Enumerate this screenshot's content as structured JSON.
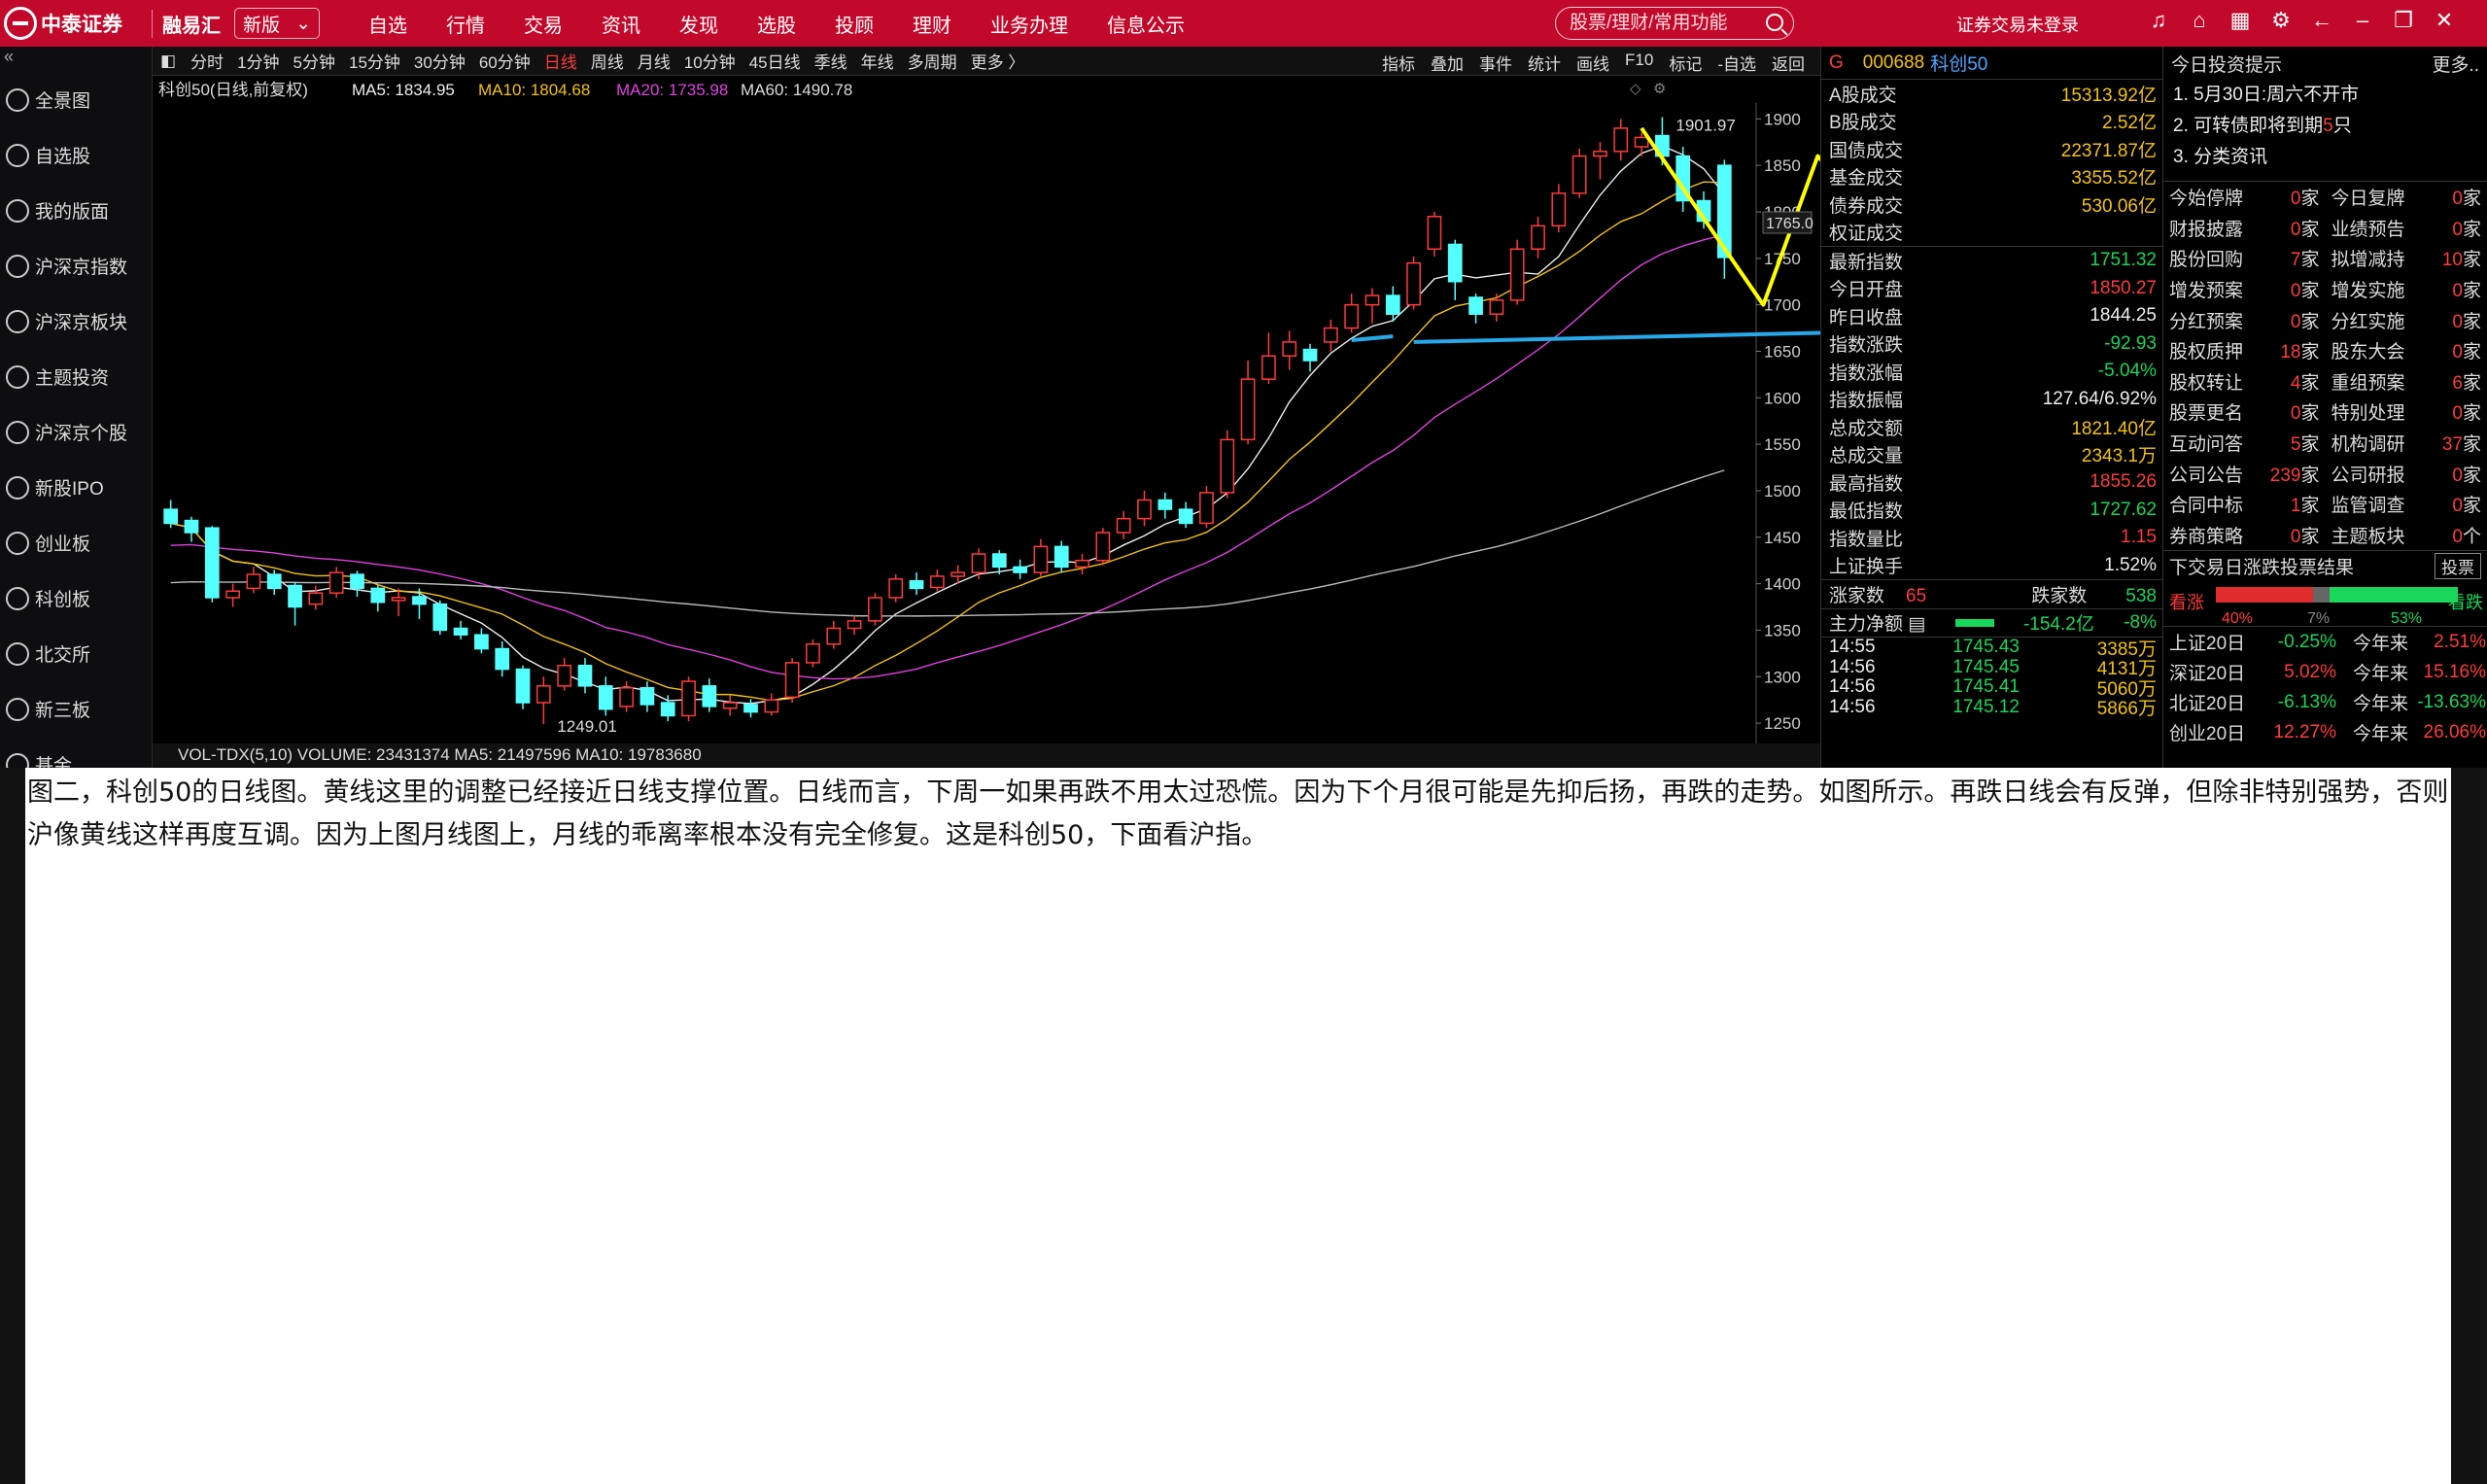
{
  "topbar": {
    "logo": "中泰证券",
    "brand": "融易汇",
    "version_select": "新版",
    "menu": [
      "自选",
      "行情",
      "交易",
      "资讯",
      "发现",
      "选股",
      "投顾",
      "理财",
      "业务办理",
      "信息公示"
    ],
    "search_placeholder": "股票/理财/常用功能",
    "login_status": "证券交易未登录"
  },
  "sidebar": {
    "items": [
      "全景图",
      "自选股",
      "我的版面",
      "沪深京指数",
      "沪深京板块",
      "主题投资",
      "沪深京个股",
      "新股IPO",
      "创业板",
      "科创板",
      "北交所",
      "新三板",
      "基金"
    ]
  },
  "toolbar": {
    "periods": [
      "分时",
      "1分钟",
      "5分钟",
      "15分钟",
      "30分钟",
      "60分钟",
      "日线",
      "周线",
      "月线",
      "10分钟",
      "45日线",
      "季线",
      "年线",
      "多周期",
      "更多 〉"
    ],
    "active_period": "日线",
    "tools": [
      "指标",
      "叠加",
      "事件",
      "统计",
      "画线",
      "F10",
      "标记",
      "-自选",
      "返回"
    ]
  },
  "chart_header": {
    "name": "科创50(日线,前复权)",
    "ma5": "MA5: 1834.95",
    "ma10": "MA10: 1804.68",
    "ma20": "MA20: 1735.98",
    "ma60": "MA60: 1490.78",
    "high_label": "1901.97",
    "low_label": "1249.01",
    "price_tag": "1765.0"
  },
  "chart_data": {
    "type": "candlestick",
    "y_ticks": [
      1900,
      1850,
      1800,
      1750,
      1700,
      1650,
      1600,
      1550,
      1500,
      1450,
      1400,
      1350,
      1300,
      1250
    ],
    "ylim": [
      1225,
      1915
    ],
    "candles": [
      [
        1480,
        1465,
        1490,
        1460
      ],
      [
        1468,
        1455,
        1472,
        1445
      ],
      [
        1460,
        1385,
        1462,
        1380
      ],
      [
        1385,
        1392,
        1400,
        1375
      ],
      [
        1395,
        1410,
        1418,
        1390
      ],
      [
        1410,
        1395,
        1415,
        1388
      ],
      [
        1398,
        1375,
        1402,
        1355
      ],
      [
        1378,
        1390,
        1398,
        1372
      ],
      [
        1390,
        1412,
        1418,
        1385
      ],
      [
        1410,
        1395,
        1414,
        1386
      ],
      [
        1395,
        1380,
        1398,
        1370
      ],
      [
        1382,
        1385,
        1395,
        1365
      ],
      [
        1386,
        1378,
        1395,
        1362
      ],
      [
        1378,
        1350,
        1382,
        1345
      ],
      [
        1352,
        1345,
        1360,
        1340
      ],
      [
        1345,
        1330,
        1352,
        1325
      ],
      [
        1330,
        1308,
        1338,
        1300
      ],
      [
        1308,
        1272,
        1312,
        1265
      ],
      [
        1272,
        1290,
        1300,
        1249
      ],
      [
        1290,
        1312,
        1320,
        1285
      ],
      [
        1312,
        1290,
        1320,
        1282
      ],
      [
        1290,
        1265,
        1300,
        1258
      ],
      [
        1268,
        1288,
        1295,
        1262
      ],
      [
        1288,
        1270,
        1295,
        1262
      ],
      [
        1272,
        1258,
        1280,
        1252
      ],
      [
        1258,
        1295,
        1300,
        1252
      ],
      [
        1290,
        1268,
        1298,
        1262
      ],
      [
        1266,
        1272,
        1280,
        1258
      ],
      [
        1270,
        1262,
        1276,
        1256
      ],
      [
        1262,
        1275,
        1282,
        1258
      ],
      [
        1278,
        1315,
        1320,
        1272
      ],
      [
        1315,
        1335,
        1340,
        1310
      ],
      [
        1335,
        1352,
        1360,
        1330
      ],
      [
        1352,
        1360,
        1366,
        1345
      ],
      [
        1360,
        1385,
        1390,
        1355
      ],
      [
        1385,
        1405,
        1410,
        1380
      ],
      [
        1403,
        1395,
        1412,
        1388
      ],
      [
        1396,
        1408,
        1415,
        1392
      ],
      [
        1408,
        1412,
        1420,
        1400
      ],
      [
        1412,
        1432,
        1438,
        1405
      ],
      [
        1432,
        1418,
        1436,
        1410
      ],
      [
        1418,
        1412,
        1426,
        1405
      ],
      [
        1412,
        1440,
        1448,
        1408
      ],
      [
        1440,
        1418,
        1446,
        1412
      ],
      [
        1418,
        1425,
        1432,
        1410
      ],
      [
        1425,
        1455,
        1460,
        1420
      ],
      [
        1455,
        1470,
        1478,
        1448
      ],
      [
        1470,
        1490,
        1500,
        1462
      ],
      [
        1490,
        1480,
        1498,
        1470
      ],
      [
        1480,
        1465,
        1488,
        1460
      ],
      [
        1465,
        1498,
        1505,
        1460
      ],
      [
        1498,
        1555,
        1565,
        1492
      ],
      [
        1555,
        1620,
        1640,
        1550
      ],
      [
        1620,
        1645,
        1670,
        1615
      ],
      [
        1645,
        1660,
        1672,
        1630
      ],
      [
        1652,
        1640,
        1658,
        1628
      ],
      [
        1660,
        1675,
        1684,
        1650
      ],
      [
        1675,
        1700,
        1712,
        1670
      ],
      [
        1700,
        1710,
        1718,
        1680
      ],
      [
        1710,
        1690,
        1720,
        1682
      ],
      [
        1700,
        1745,
        1752,
        1695
      ],
      [
        1760,
        1795,
        1800,
        1752
      ],
      [
        1765,
        1725,
        1770,
        1705
      ],
      [
        1708,
        1690,
        1712,
        1680
      ],
      [
        1690,
        1705,
        1712,
        1682
      ],
      [
        1705,
        1760,
        1770,
        1700
      ],
      [
        1760,
        1785,
        1795,
        1750
      ],
      [
        1785,
        1820,
        1830,
        1778
      ],
      [
        1820,
        1860,
        1868,
        1815
      ],
      [
        1860,
        1865,
        1875,
        1835
      ],
      [
        1865,
        1890,
        1900,
        1855
      ],
      [
        1870,
        1880,
        1885,
        1860
      ],
      [
        1882,
        1860,
        1902,
        1850
      ],
      [
        1860,
        1812,
        1870,
        1800
      ],
      [
        1812,
        1790,
        1822,
        1782
      ],
      [
        1850,
        1751,
        1856,
        1728
      ]
    ],
    "ma_lines": [
      "MA5",
      "MA10",
      "MA20",
      "MA60"
    ],
    "annotations": [
      "yellow zigzag projection",
      "blue support line"
    ]
  },
  "volume_bar": "VOL-TDX(5,10)  VOLUME: 23431374  MA5: 21497596  MA10: 19783680",
  "quote": {
    "g": "G",
    "code": "000688",
    "name": "科创50",
    "turnover": [
      {
        "label": "A股成交",
        "value": "15313.92亿"
      },
      {
        "label": "B股成交",
        "value": "2.52亿"
      },
      {
        "label": "国债成交",
        "value": "22371.87亿"
      },
      {
        "label": "基金成交",
        "value": "3355.52亿"
      },
      {
        "label": "债券成交",
        "value": "530.06亿"
      },
      {
        "label": "权证成交",
        "value": ""
      }
    ],
    "stats": [
      {
        "label": "最新指数",
        "value": "1751.32",
        "color": "green"
      },
      {
        "label": "今日开盘",
        "value": "1850.27",
        "color": "red"
      },
      {
        "label": "昨日收盘",
        "value": "1844.25",
        "color": "white"
      },
      {
        "label": "指数涨跌",
        "value": "-92.93",
        "color": "green"
      },
      {
        "label": "指数涨幅",
        "value": "-5.04%",
        "color": "green"
      },
      {
        "label": "指数振幅",
        "value": "127.64/6.92%",
        "color": "white"
      },
      {
        "label": "总成交额",
        "value": "1821.40亿",
        "color": "yellow"
      },
      {
        "label": "总成交量",
        "value": "2343.1万",
        "color": "yellow"
      },
      {
        "label": "最高指数",
        "value": "1855.26",
        "color": "red"
      },
      {
        "label": "最低指数",
        "value": "1727.62",
        "color": "green"
      },
      {
        "label": "指数量比",
        "value": "1.15",
        "color": "red"
      },
      {
        "label": "上证换手",
        "value": "1.52%",
        "color": "white"
      }
    ],
    "updown": {
      "up_label": "涨家数",
      "up": "65",
      "down_label": "跌家数",
      "down": "538"
    },
    "mainflow": {
      "label": "主力净额",
      "value": "-154.2亿",
      "pct": "-8%"
    },
    "ticks": [
      {
        "time": "14:55",
        "price": "1745.43",
        "vol": "3385万"
      },
      {
        "time": "14:56",
        "price": "1745.45",
        "vol": "4131万"
      },
      {
        "time": "14:56",
        "price": "1745.41",
        "vol": "5060万"
      },
      {
        "time": "14:56",
        "price": "1745.12",
        "vol": "5866万"
      }
    ]
  },
  "info": {
    "title": "今日投资提示",
    "more": "更多..",
    "items": [
      {
        "text": "1. 5月30日:周六不开市"
      },
      {
        "pre": "2. 可转债即将到期",
        "num": "5",
        "post": "只"
      },
      {
        "text": "3. 分类资讯"
      }
    ],
    "grid": [
      [
        "今始停牌",
        "0",
        "今日复牌",
        "0"
      ],
      [
        "财报披露",
        "0",
        "业绩预告",
        "0"
      ],
      [
        "股份回购",
        "7",
        "拟增减持",
        "10"
      ],
      [
        "增发预案",
        "0",
        "增发实施",
        "0"
      ],
      [
        "分红预案",
        "0",
        "分红实施",
        "0"
      ],
      [
        "股权质押",
        "18",
        "股东大会",
        "0"
      ],
      [
        "股权转让",
        "4",
        "重组预案",
        "6"
      ],
      [
        "股票更名",
        "0",
        "特别处理",
        "0"
      ],
      [
        "互动问答",
        "5",
        "机构调研",
        "37"
      ],
      [
        "公司公告",
        "239",
        "公司研报",
        "0"
      ],
      [
        "合同中标",
        "1",
        "监管调查",
        "0"
      ],
      [
        "券商策略",
        "0",
        "主题板块",
        "0"
      ]
    ],
    "unit": "家",
    "unit_last": "个",
    "vote_title": "下交易日涨跌投票结果",
    "vote_btn": "投票",
    "vote_bull": "看涨",
    "vote_bear": "看跌",
    "vote_pcts": [
      "40%",
      "7%",
      "53%"
    ],
    "perf": [
      {
        "name": "上证20日",
        "v1": "-0.25%",
        "ytd": "今年来",
        "v2": "2.51%"
      },
      {
        "name": "深证20日",
        "v1": "5.02%",
        "ytd": "今年来",
        "v2": "15.16%"
      },
      {
        "name": "北证20日",
        "v1": "-6.13%",
        "ytd": "今年来",
        "v2": "-13.63%"
      },
      {
        "name": "创业20日",
        "v1": "12.27%",
        "ytd": "今年来",
        "v2": "26.06%"
      }
    ]
  },
  "note": "图二，科创50的日线图。黄线这里的调整已经接近日线支撑位置。日线而言，下周一如果再跌不用太过恐慌。因为下个月很可能是先抑后扬，再跌的走势。如图所示。再跌日线会有反弹，但除非特别强势，否则沪像黄线这样再度互调。因为上图月线图上，月线的乖离率根本没有完全修复。这是科创50，下面看沪指。"
}
